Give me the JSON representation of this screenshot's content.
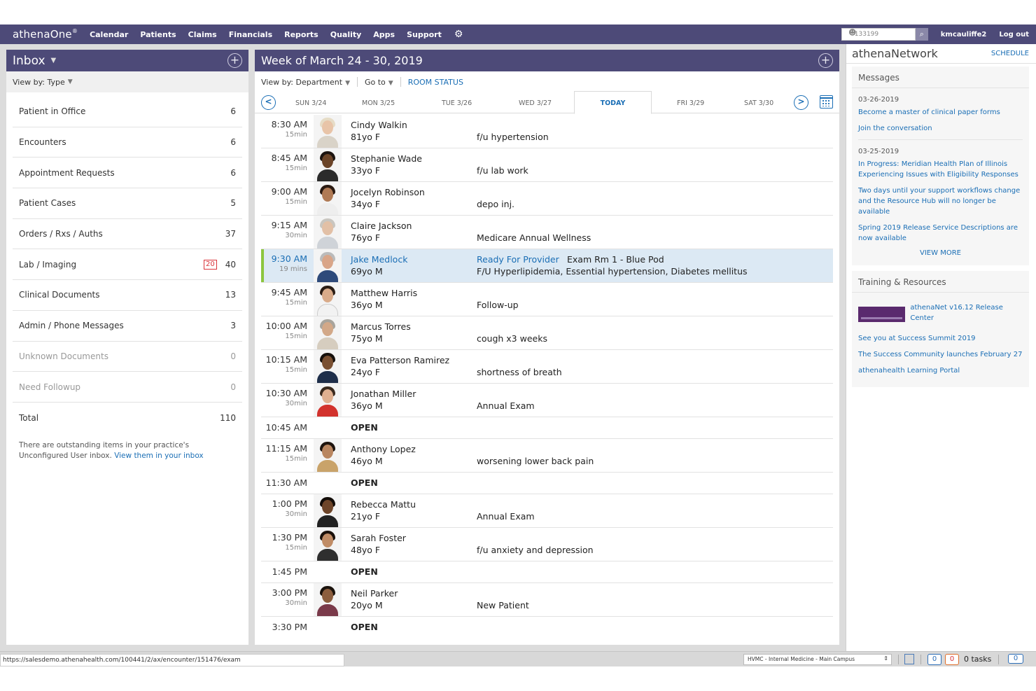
{
  "topnav": {
    "logo": "athenaOne",
    "logo_mark": "®",
    "items": [
      "Calendar",
      "Patients",
      "Claims",
      "Financials",
      "Reports",
      "Quality",
      "Apps",
      "Support"
    ],
    "search_value": "133199",
    "username": "kmcauliffe2",
    "logout": "Log out",
    "icons": {
      "settings": "gear-icon",
      "search": "search-icon",
      "user": "user-icon"
    }
  },
  "inbox": {
    "title": "Inbox",
    "view_by": "View by: Type",
    "rows": [
      {
        "label": "Patient in Office",
        "count": "6"
      },
      {
        "label": "Encounters",
        "count": "6"
      },
      {
        "label": "Appointment Requests",
        "count": "6"
      },
      {
        "label": "Patient Cases",
        "count": "5"
      },
      {
        "label": "Orders / Rxs / Auths",
        "count": "37"
      },
      {
        "label": "Lab / Imaging",
        "count": "40",
        "urgent": "20"
      },
      {
        "label": "Clinical Documents",
        "count": "13"
      },
      {
        "label": "Admin / Phone Messages",
        "count": "3"
      },
      {
        "label": "Unknown Documents",
        "count": "0"
      },
      {
        "label": "Need Followup",
        "count": "0"
      },
      {
        "label": "Total",
        "count": "110"
      }
    ],
    "note": "There are outstanding items in your practice's Unconfigured User inbox.",
    "note_link": "View them in your inbox"
  },
  "schedule": {
    "title": "Week of March 24 - 30, 2019",
    "view_by": "View by: Department",
    "goto": "Go to",
    "room_status": "ROOM STATUS",
    "days": [
      "SUN 3/24",
      "MON 3/25",
      "TUE 3/26",
      "WED 3/27",
      "TODAY",
      "FRI 3/29",
      "SAT 3/30"
    ],
    "appointments": [
      {
        "time": "8:30 AM",
        "dur": "15min",
        "name": "Cindy Walkin",
        "age": "81yo F",
        "reason": "f/u hypertension"
      },
      {
        "time": "8:45 AM",
        "dur": "15min",
        "name": "Stephanie Wade",
        "age": "33yo F",
        "reason": "f/u lab work"
      },
      {
        "time": "9:00 AM",
        "dur": "15min",
        "name": "Jocelyn Robinson",
        "age": "34yo F",
        "reason": "depo inj."
      },
      {
        "time": "9:15 AM",
        "dur": "30min",
        "name": "Claire Jackson",
        "age": "76yo F",
        "reason": "Medicare Annual Wellness"
      },
      {
        "time": "9:30 AM",
        "dur": "19 mins",
        "name": "Jake Medlock",
        "age": "69yo M",
        "status": "Ready For Provider",
        "room": "Exam Rm 1 - Blue Pod",
        "reason": "F/U Hyperlipidemia, Essential hypertension, Diabetes mellitus"
      },
      {
        "time": "9:45 AM",
        "dur": "15min",
        "name": "Matthew Harris",
        "age": "36yo M",
        "reason": "Follow-up"
      },
      {
        "time": "10:00 AM",
        "dur": "15min",
        "name": "Marcus Torres",
        "age": "75yo M",
        "reason": "cough x3 weeks"
      },
      {
        "time": "10:15 AM",
        "dur": "15min",
        "name": "Eva Patterson Ramirez",
        "age": "24yo F",
        "reason": "shortness of breath"
      },
      {
        "time": "10:30 AM",
        "dur": "30min",
        "name": "Jonathan Miller",
        "age": "36yo M",
        "reason": "Annual Exam"
      },
      {
        "time": "10:45 AM",
        "open": "OPEN"
      },
      {
        "time": "11:15 AM",
        "dur": "15min",
        "name": "Anthony Lopez",
        "age": "46yo M",
        "reason": "worsening lower back pain"
      },
      {
        "time": "11:30 AM",
        "open": "OPEN"
      },
      {
        "time": "1:00 PM",
        "dur": "30min",
        "name": "Rebecca Mattu",
        "age": "21yo F",
        "reason": "Annual Exam"
      },
      {
        "time": "1:30 PM",
        "dur": "15min",
        "name": "Sarah Foster",
        "age": "48yo F",
        "reason": "f/u anxiety and depression"
      },
      {
        "time": "1:45 PM",
        "open": "OPEN"
      },
      {
        "time": "3:00 PM",
        "dur": "30min",
        "name": "Neil Parker",
        "age": "20yo M",
        "reason": "New Patient"
      },
      {
        "time": "3:30 PM",
        "open": "OPEN"
      }
    ]
  },
  "network": {
    "title": "athenaNetwork",
    "schedule_link": "SCHEDULE",
    "messages_title": "Messages",
    "groups": [
      {
        "date": "03-26-2019",
        "items": [
          "Become a master of clinical paper forms",
          "Join the conversation"
        ]
      },
      {
        "date": "03-25-2019",
        "items": [
          "In Progress: Meridian Health Plan of Illinois Experiencing Issues with Eligibility Responses",
          "Two days until your support workflows change and the Resource Hub will no longer be available",
          "Spring 2019 Release Service Descriptions are now available"
        ]
      }
    ],
    "view_more": "VIEW MORE",
    "training_title": "Training & Resources",
    "training_feature": "athenaNet v16.12 Release Center",
    "training_links": [
      "See you at Success Summit 2019",
      "The Success Community launches February 27",
      "athenahealth Learning Portal"
    ]
  },
  "statusbar": {
    "url": "https://salesdemo.athenahealth.com/100441/2/ax/encounter/151476/exam",
    "department": "HVMC - Internal Medicine - Main Campus",
    "badge_blue": "0",
    "badge_red": "0",
    "tasks": "0 tasks",
    "chat": "0"
  },
  "colors": {
    "nav": "#4d4a78",
    "link": "#1a6eb5",
    "active_row": "#dce9f4",
    "active_bar": "#8cc63f",
    "urgent": "#d9333a"
  }
}
